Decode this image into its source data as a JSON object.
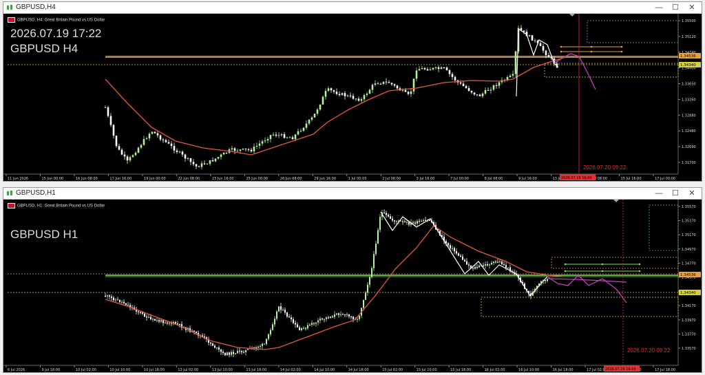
{
  "windows": [
    {
      "title": "GBPUSD,H4",
      "header": "GBPUSD, H4:  Great Britain Pound vs US Dollar",
      "datetime": "2026.07.19 17:22",
      "symbol_label": "GBPUSD H4",
      "price_labels": [
        "1.35500",
        "1.35120",
        "1.34740",
        "1.34400",
        "1.33650",
        "1.33260",
        "1.32880",
        "1.32480",
        "1.32090",
        "1.31700"
      ],
      "badges": [
        "1.34536",
        "1.34340"
      ],
      "time_labels": [
        "11 Jun 2026",
        "15 Jun 00:00",
        "16 Jun 08:00",
        "17 Jun 16:00",
        "19 Jun 00:00",
        "22 Jun 08:00",
        "23 Jun 16:00",
        "25 Jun 00:00",
        "26 Jun 08:00",
        "29 Jun 16:00",
        "1 Jul 00:00",
        "2 Jul 08:00",
        "3 Jul 16:00",
        "7 Jul 00:00",
        "8 Jul 08:00",
        "9 Jul 16:00",
        "13 Jul 00:00",
        "14 Jul 08:00",
        "15 Jul 16:00",
        "17 Jul 00:00"
      ],
      "cursor_time": "2026.07.20 09:22",
      "cursor_badge": "2026.07.19 16:00"
    },
    {
      "title": "GBPUSD,H1",
      "header": "GBPUSD, H1:  Great Britain Pound vs US Dollar",
      "symbol_label": "GBPUSD H1",
      "price_labels": [
        "1.35570",
        "1.35370",
        "1.35170",
        "1.34970",
        "1.34770",
        "1.34570",
        "1.34370",
        "1.34170",
        "1.33970",
        "1.33770",
        "1.33570"
      ],
      "badges": [
        "1.34536",
        "1.34340"
      ],
      "time_labels": [
        "6 Jul 2026",
        "9 Jul 18:00",
        "10 Jul 02:00",
        "10 Jul 10:00",
        "10 Jul 18:00",
        "13 Jul 02:00",
        "13 Jul 10:00",
        "13 Jul 18:00",
        "14 Jul 02:00",
        "14 Jul 10:00",
        "14 Jul 18:00",
        "15 Jul 02:00",
        "15 Jul 10:00",
        "15 Jul 18:00",
        "16 Jul 02:00",
        "16 Jul 10:00",
        "16 Jul 18:00",
        "17 Jul 02:00",
        "17 Jul 10:00",
        "17 Jul 18:00"
      ],
      "cursor_time": "2026.07.20 09:22",
      "cursor_badge": "2026.07.19 16:00"
    }
  ],
  "colors": {
    "bull": "#b6f0a0",
    "bear": "#ffffff",
    "ma": "#e8583a",
    "zigzag": "#ffffff",
    "forecast": "#c040c0",
    "level_orange": "#e8a040",
    "level_yellow": "#d4d040",
    "level_green": "#80e060",
    "cursor": "#e03030",
    "zone_cyan": "#40b0c0"
  }
}
